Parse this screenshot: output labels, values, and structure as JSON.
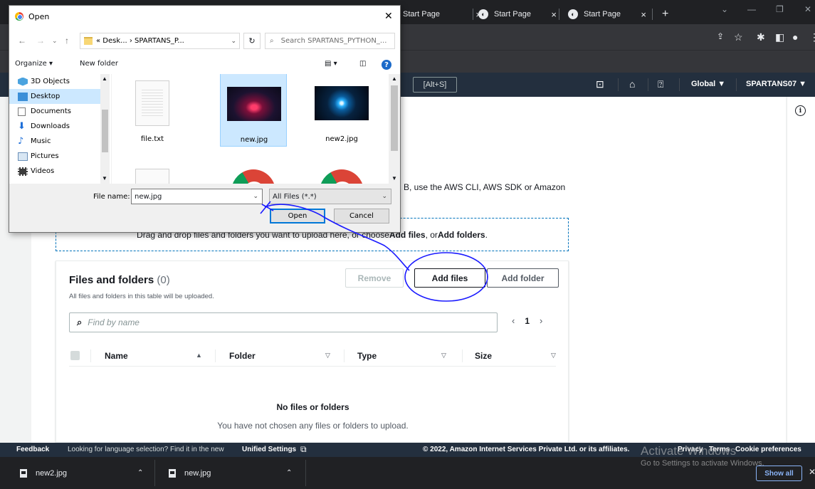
{
  "browser": {
    "tabs": [
      {
        "label": "Start Page"
      },
      {
        "label": "Start Page"
      },
      {
        "label": "Start Page"
      }
    ],
    "new_tab_symbol": "+",
    "close_symbol": "×"
  },
  "aws_header": {
    "search_shortcut": "[Alt+S]",
    "region": "Global ▼",
    "account": "SPARTANS07 ▼"
  },
  "upload": {
    "description_tail": "B, use the AWS CLI, AWS SDK or Amazon",
    "dropzone": {
      "prefix": "Drag and drop files and folders you want to upload here, or choose ",
      "add_files": "Add files",
      "middle": ", or ",
      "add_folders": "Add folders",
      "suffix": "."
    },
    "files_panel": {
      "title": "Files and folders",
      "count": "(0)",
      "subtitle": "All files and folders in this table will be uploaded.",
      "buttons": {
        "remove": "Remove",
        "add_files": "Add files",
        "add_folder": "Add folder"
      },
      "search_placeholder": "Find by name",
      "pagination": {
        "prev": "‹",
        "page": "1",
        "next": "›"
      },
      "columns": [
        "Name",
        "Folder",
        "Type",
        "Size"
      ],
      "empty_title": "No files or folders",
      "empty_subtitle": "You have not chosen any files or folders to upload."
    }
  },
  "footer": {
    "feedback": "Feedback",
    "language_prompt": "Looking for language selection? Find it in the new",
    "unified_settings": "Unified Settings",
    "copyright": "© 2022, Amazon Internet Services Private Ltd. or its affiliates.",
    "privacy": "Privacy",
    "terms": "Terms",
    "cookie_preferences": "Cookie preferences"
  },
  "downloads": {
    "items": [
      {
        "name": "new2.jpg"
      },
      {
        "name": "new.jpg"
      }
    ],
    "show_all": "Show all"
  },
  "watermark": {
    "title": "Activate Windows",
    "subtitle": "Go to Settings to activate Windows."
  },
  "open_dialog": {
    "title": "Open",
    "path": "« Desk... › SPARTANS_P...",
    "search_placeholder": "Search SPARTANS_PYTHON_...",
    "organize": "Organize ▾",
    "new_folder": "New folder",
    "nav_items": [
      {
        "label": "3D Objects",
        "icon": "cube-icon"
      },
      {
        "label": "Desktop",
        "icon": "desktop-icon"
      },
      {
        "label": "Documents",
        "icon": "documents-icon"
      },
      {
        "label": "Downloads",
        "icon": "download-arrow-icon"
      },
      {
        "label": "Music",
        "icon": "music-note-icon"
      },
      {
        "label": "Pictures",
        "icon": "pictures-icon"
      },
      {
        "label": "Videos",
        "icon": "film-icon"
      }
    ],
    "selected_nav": "Desktop",
    "files": [
      {
        "name": "file.txt",
        "icon": "text-file-icon"
      },
      {
        "name": "new.jpg",
        "icon": "image-thumbnail"
      },
      {
        "name": "new2.jpg",
        "icon": "image-thumbnail"
      },
      {
        "name": "",
        "icon": "python-file-icon"
      },
      {
        "name": "",
        "icon": "chrome-icon"
      },
      {
        "name": "",
        "icon": "chrome-icon"
      }
    ],
    "selected_file": "new.jpg",
    "file_name_label": "File name:",
    "file_name_value": "new.jpg",
    "file_type": "All Files (*.*)",
    "open_button": "Open",
    "cancel_button": "Cancel"
  },
  "colors": {
    "aws_header": "#232f3e",
    "aws_link": "#0073bb",
    "dialog_selection": "#cce8ff",
    "annotation_ink": "#1a1aff"
  }
}
